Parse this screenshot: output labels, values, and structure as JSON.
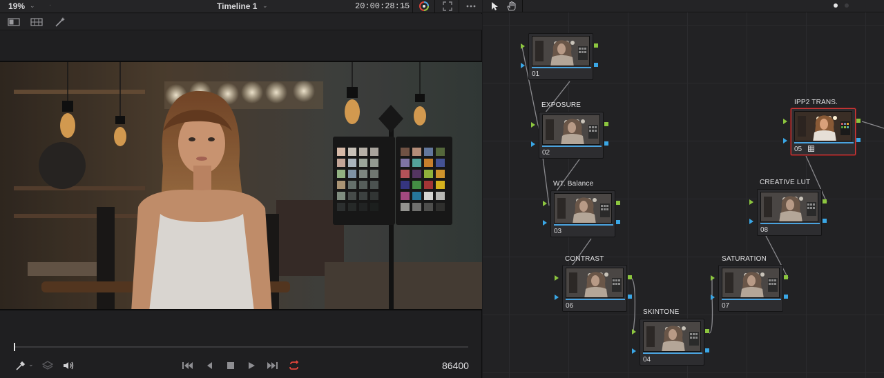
{
  "viewer": {
    "zoom": "19%",
    "timeline_title": "Timeline 1",
    "timecode": "20:00:28:15",
    "frame_counter": "86400"
  },
  "icons": {
    "zoom_dropdown": "chevron-down-icon",
    "timeline_dropdown": "chevron-down-icon",
    "timecode_dropdown": "chevron-down-icon",
    "color_wheel": "color-wheel-icon",
    "fullscreen": "expand-icon",
    "more": "more-icon",
    "pointer": "pointer-icon",
    "hand": "hand-icon",
    "picker": "eyedropper-icon",
    "layers": "layers-icon",
    "speaker": "speaker-icon",
    "skip_back": "skip-back-icon",
    "step_back": "step-back-icon",
    "stop": "stop-icon",
    "play": "play-icon",
    "skip_fwd": "skip-forward-icon",
    "loop": "loop-icon"
  },
  "colors": {
    "accent_red": "#e0443a",
    "node_input_green": "#8cc63f",
    "node_key_blue": "#3aa7e6",
    "selected_border": "#d03a3a"
  },
  "nodes": [
    {
      "number": "01",
      "label": ""
    },
    {
      "number": "02",
      "label": "EXPOSURE"
    },
    {
      "number": "03",
      "label": "WT. Balance"
    },
    {
      "number": "06",
      "label": "CONTRAST"
    },
    {
      "number": "04",
      "label": "SKINTONE"
    },
    {
      "number": "07",
      "label": "SATURATION"
    },
    {
      "number": "08",
      "label": "CREATIVE LUT"
    },
    {
      "number": "05",
      "label": "IPP2 TRANS."
    }
  ]
}
